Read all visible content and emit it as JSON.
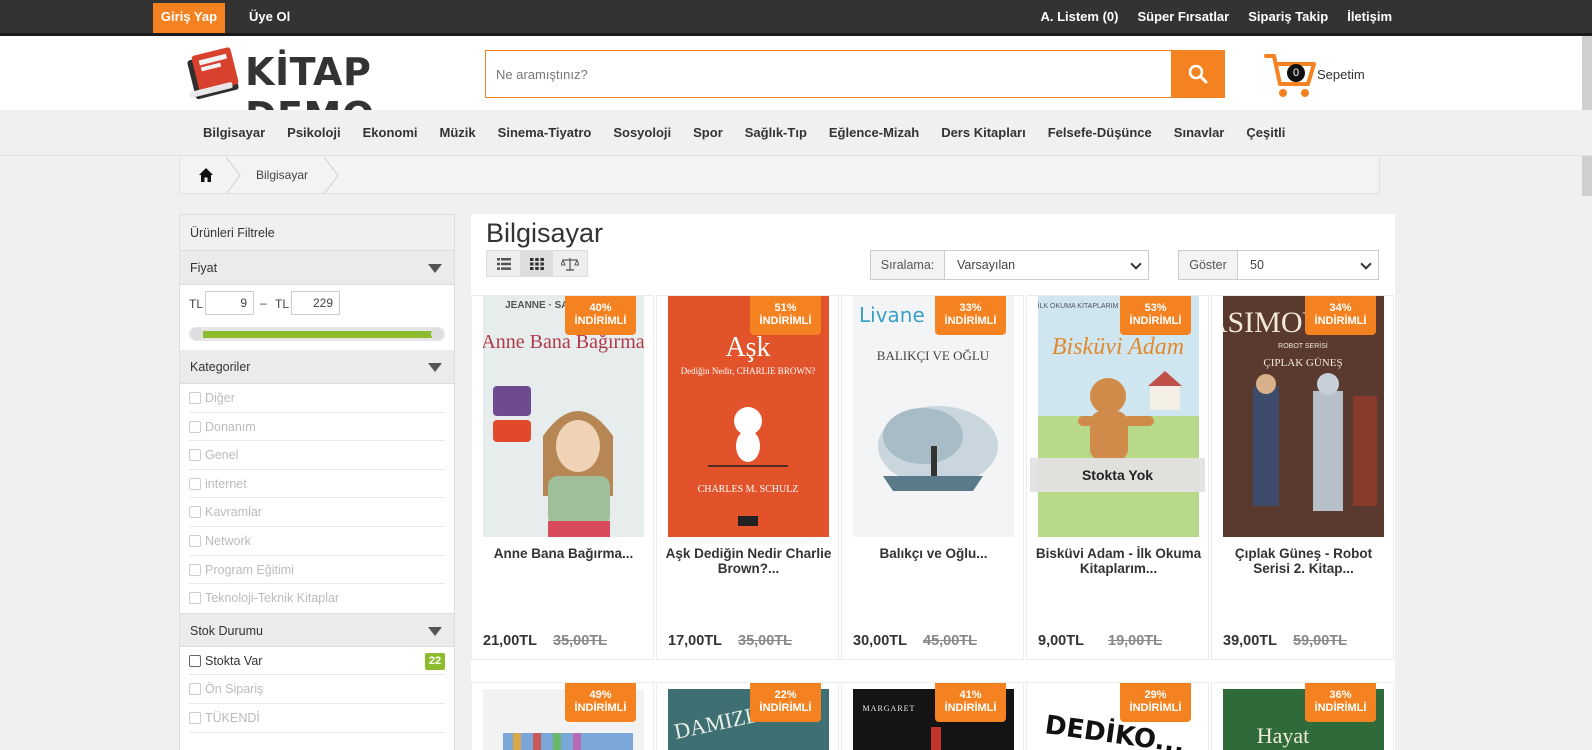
{
  "topbar": {
    "login_label": "Giriş Yap",
    "signup_label": "Üye Ol",
    "links": [
      "A. Listem (0)",
      "Süper Fırsatlar",
      "Sipariş Takip",
      "İletişim"
    ]
  },
  "header": {
    "logo_text": "KİTAP DEMO",
    "search_placeholder": "Ne aramıştınız?",
    "cart_count": "0",
    "cart_label": "Sepetim"
  },
  "nav": {
    "categories": [
      "Bilgisayar",
      "Psikoloji",
      "Ekonomi",
      "Müzik",
      "Sinema-Tiyatro",
      "Sosyoloji",
      "Spor",
      "Sağlık-Tıp",
      "Eğlence-Mizah",
      "Ders Kitapları",
      "Felsefe-Düşünce",
      "Sınavlar",
      "Çeşitli"
    ]
  },
  "breadcrumb": {
    "current": "Bilgisayar"
  },
  "sidebar": {
    "title": "Ürünleri Filtrele",
    "price": {
      "label": "Fiyat",
      "currency_min": "TL",
      "min": "9",
      "currency_max": "TL",
      "max": "229",
      "dash": "–"
    },
    "categories": {
      "label": "Kategoriler",
      "items": [
        "Diğer",
        "Donanım",
        "Genel",
        "internet",
        "Kavramlar",
        "Network",
        "Program Eğitimi",
        "Teknoloji-Teknik Kitaplar"
      ]
    },
    "stock": {
      "label": "Stok Durumu",
      "items": [
        {
          "label": "Stokta Var",
          "count": "22"
        },
        {
          "label": "Ön Sipariş"
        },
        {
          "label": "TÜKENDİ"
        }
      ]
    }
  },
  "main": {
    "title": "Bilgisayar",
    "sort_label": "Sıralama:",
    "sort_value": "Varsayılan",
    "show_label": "Göster",
    "show_value": "50"
  },
  "products": [
    {
      "name": "Anne Bana Bağırma...",
      "price": "21,00TL",
      "old_price": "35,00TL",
      "discount_pct": "40%",
      "discount_word": "İNDİRİMLİ",
      "cover_color": "#e7ecec",
      "cover_title": "Anne Bana Bağırma",
      "cover_author": "JEANNE · SANDRA TE..."
    },
    {
      "name": "Aşk Dediğin Nedir Charlie Brown?...",
      "price": "17,00TL",
      "old_price": "35,00TL",
      "discount_pct": "51%",
      "discount_word": "İNDİRİMLİ",
      "cover_color": "#e2532b",
      "cover_title": "Aşk",
      "cover_sub": "Dediğin Nedir, CHARLIE BROWN?",
      "cover_author": "CHARLES M. SCHULZ"
    },
    {
      "name": "Balıkçı ve Oğlu...",
      "price": "30,00TL",
      "old_price": "45,00TL",
      "discount_pct": "33%",
      "discount_word": "İNDİRİMLİ",
      "cover_color": "#f3f4f5",
      "cover_title": "BALIKÇI VE OĞLU",
      "cover_author": "Livane"
    },
    {
      "name": "Bisküvi Adam - İlk Okuma Kitaplarım...",
      "price": "9,00TL",
      "old_price": "19,00TL",
      "discount_pct": "53%",
      "discount_word": "İNDİRİMLİ",
      "cover_color": "#d9ecd2",
      "cover_title": "Bisküvi Adam",
      "cover_author": "İLK OKUMA KİTAPLARIM",
      "out_of_stock": "Stokta Yok"
    },
    {
      "name": "Çıplak Güneş - Robot Serisi 2. Kitap...",
      "price": "39,00TL",
      "old_price": "59,00TL",
      "discount_pct": "34%",
      "discount_word": "İNDİRİMLİ",
      "cover_color": "#5a3a2e",
      "cover_title": "ASIMOV",
      "cover_sub": "ÇIPLAK GÜNEŞ",
      "cover_author": "ROBOT SERİSİ"
    }
  ],
  "products_row2": [
    {
      "discount_pct": "49%",
      "discount_word": "İNDİRİMLİ",
      "cover_color": "#f2f2f2"
    },
    {
      "discount_pct": "22%",
      "discount_word": "İNDİRİMLİ",
      "cover_color": "#3e6f72",
      "cover_title": "DAMIZL..."
    },
    {
      "discount_pct": "41%",
      "discount_word": "İNDİRİMLİ",
      "cover_color": "#141414",
      "cover_title": "MARGARET"
    },
    {
      "discount_pct": "29%",
      "discount_word": "İNDİRİMLİ",
      "cover_color": "#ffffff",
      "cover_title": "DEDİKO..."
    },
    {
      "discount_pct": "36%",
      "discount_word": "İNDİRİMLİ",
      "cover_color": "#2f6b3a",
      "cover_title": "Hayat"
    }
  ],
  "colors": {
    "accent": "#f58220",
    "green": "#8dbd2e",
    "topbar": "#333333"
  }
}
